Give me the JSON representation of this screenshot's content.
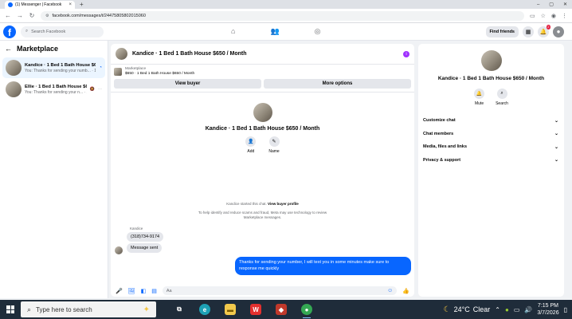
{
  "browser": {
    "tab_title": "(1) Messenger | Facebook",
    "new_tab": "+",
    "url": "facebook.com/messages/t/24475805802015060",
    "win_min": "–",
    "win_max": "▢",
    "win_close": "✕"
  },
  "fb": {
    "logo": "f",
    "search_placeholder": "Search Facebook",
    "find_friends": "Find friends",
    "notifications_count": "2"
  },
  "left": {
    "title": "Marketplace",
    "conversations": [
      {
        "title": "Kandice · 1 Bed 1 Bath House $6...",
        "preview": "You: Thanks for sending your numb... · 1m",
        "active": true
      },
      {
        "title": "Ellie · 1 Bed 1 Bath House $6...",
        "preview": "You: Thanks for sending your n... · 1d",
        "active": false
      }
    ]
  },
  "chat": {
    "title": "Kandice · 1 Bed 1 Bath House $650 / Month",
    "listing_label": "Marketplace",
    "listing_detail": "$650 · 1 Bed 1 Bath House $650 / Month",
    "view_buyer": "View buyer",
    "more_options": "More options",
    "profile_title": "Kandice · 1 Bed 1 Bath House $650 / Month",
    "add_label": "Add",
    "name_label": "Name",
    "started_text": "Kandice started this chat.",
    "view_buyer_profile": "View buyer profile",
    "scam_notice_1": "To help identify and reduce scams and fraud, Meta may use technology to review",
    "scam_notice_2": "Marketplace messages.",
    "sender_name": "Kandice",
    "msg_phone": "(318)734-9174",
    "msg_sent": "Message sent",
    "msg_out": "Thanks for sending your number, I will text you in some minutes make sure to response me quickly",
    "composer_placeholder": "Aa"
  },
  "right": {
    "title": "Kandice · 1 Bed 1 Bath House $650 / Month",
    "mute": "Mute",
    "search": "Search",
    "sections": [
      "Customize chat",
      "Chat members",
      "Media, files and links",
      "Privacy & support"
    ]
  },
  "taskbar": {
    "search_placeholder": "Type here to search",
    "temperature": "24°C",
    "weather": "Clear",
    "time": "7:15 PM",
    "date": "3/7/2026"
  }
}
